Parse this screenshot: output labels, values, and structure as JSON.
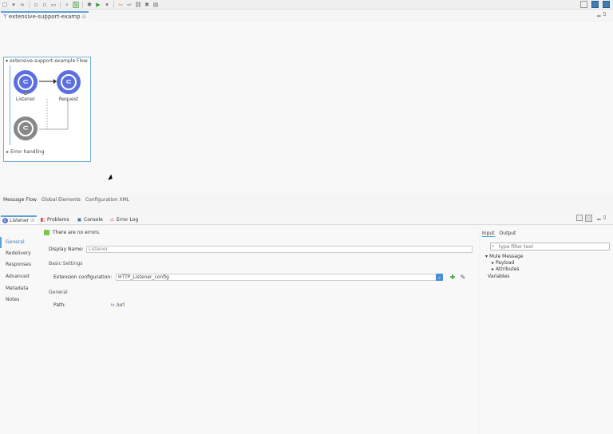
{
  "toolbar": {
    "icons": [
      "new-icon",
      "undo-icon",
      "redo-icon",
      "save-icon",
      "save-all-icon",
      "cut-icon",
      "copy-icon",
      "paste-icon",
      "search-icon",
      "debug-icon",
      "run-icon",
      "back-icon",
      "forward-icon",
      "link-icon",
      "delete-icon",
      "open-icon"
    ]
  },
  "editor": {
    "tab_label": "extensive-support-examp",
    "tab_close": "☒"
  },
  "flow": {
    "title": "extensive-support-example Flow",
    "listener_label": "Listener",
    "request_label": "Request",
    "error_handling_label": "Error handling"
  },
  "bottom_tabs": {
    "message_flow": "Message Flow",
    "global_elements": "Global Elements",
    "configuration_xml": "Configuration XML"
  },
  "panel_tabs": {
    "listener": "Listener",
    "listener_close": "☒",
    "problems": "Problems",
    "console": "Console",
    "error_log": "Error Log"
  },
  "sidenav": {
    "items": [
      "General",
      "Redelivery",
      "Responses",
      "Advanced",
      "Metadata",
      "Notes"
    ]
  },
  "properties": {
    "status_message": "There are no errors.",
    "display_name_label": "Display Name:",
    "display_name_value": "Listener",
    "basic_settings_label": "Basic Settings",
    "extension_config_label": "Extension configuration:",
    "extension_config_value": "HTTP_Listener_config",
    "general_section_label": "General",
    "path_label": "Path:",
    "path_value": "/url",
    "path_mode_icon": "fx"
  },
  "right_panel": {
    "input_tab": "Input",
    "output_tab": "Output",
    "search_placeholder": "type filter text",
    "tree": [
      "Mule Message",
      "Payload",
      "Attributes",
      "Variables"
    ]
  },
  "colors": {
    "accent": "#5aa2d8",
    "node_blue": "#5b6fe0",
    "node_gray": "#888888",
    "ok_green": "#7ec74a"
  }
}
